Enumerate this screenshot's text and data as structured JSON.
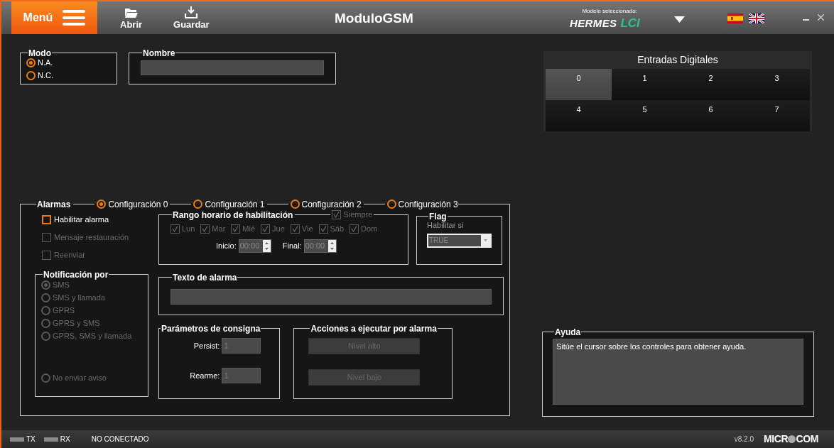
{
  "header": {
    "menu": "Menú",
    "toolbar": [
      {
        "label": "Abrir",
        "kind": "open"
      },
      {
        "label": "Guardar",
        "kind": "save"
      }
    ],
    "title": "ModuloGSM",
    "model_label": "Modelo seleccionado:",
    "model": "HERMES",
    "model_suffix": "LCI",
    "languages": [
      {
        "kind": "es"
      },
      {
        "kind": "en"
      }
    ]
  },
  "modo": {
    "title": "Modo",
    "options": [
      {
        "label": "N.A.",
        "selected": true
      },
      {
        "label": "N.C.",
        "selected": false
      }
    ]
  },
  "nombre": {
    "title": "Nombre"
  },
  "entradas": {
    "title": "Entradas Digitales",
    "inputs": [
      {
        "label": "0",
        "selected": true
      },
      {
        "label": "1",
        "selected": false
      },
      {
        "label": "2",
        "selected": false
      },
      {
        "label": "3",
        "selected": false
      },
      {
        "label": "4",
        "selected": false
      },
      {
        "label": "5",
        "selected": false
      },
      {
        "label": "6",
        "selected": false
      },
      {
        "label": "7",
        "selected": false
      }
    ]
  },
  "alarmas": {
    "title": "Alarmas",
    "configs": [
      {
        "label": "Configuración 0",
        "selected": true
      },
      {
        "label": "Configuración 1",
        "selected": false
      },
      {
        "label": "Configuración 2",
        "selected": false
      },
      {
        "label": "Configuración 3",
        "selected": false
      }
    ],
    "options": [
      {
        "label": "Habilitar alarma",
        "checked": false,
        "disabled": false
      },
      {
        "label": "Mensaje restauración",
        "checked": false,
        "disabled": true
      },
      {
        "label": "Reenviar",
        "checked": false,
        "disabled": true
      }
    ],
    "rango": {
      "title": "Rango horario de habilitación",
      "disabled": true,
      "siempre": {
        "label": "Siempre",
        "checked": true
      },
      "days": [
        {
          "label": "Lun",
          "checked": true
        },
        {
          "label": "Mar",
          "checked": true
        },
        {
          "label": "Mié",
          "checked": true
        },
        {
          "label": "Jue",
          "checked": true
        },
        {
          "label": "Vie",
          "checked": true
        },
        {
          "label": "Sáb",
          "checked": true
        },
        {
          "label": "Dom",
          "checked": true
        }
      ],
      "start_label": "Inicio:",
      "start": "00:00",
      "end_label": "Final:",
      "end": "00:00"
    },
    "flag": {
      "title": "Flag",
      "label": "Habilitar si",
      "value": "TRUE"
    },
    "notificacion": {
      "title": "Notificación por",
      "disabled": true,
      "options": [
        {
          "label": "SMS",
          "selected": true
        },
        {
          "label": "SMS y llamada",
          "selected": false
        },
        {
          "label": "GPRS",
          "selected": false
        },
        {
          "label": "GPRS y SMS",
          "selected": false
        },
        {
          "label": "GPRS, SMS y llamada",
          "selected": false
        },
        {
          "label": "No enviar aviso",
          "selected": false
        }
      ]
    },
    "texto": {
      "title": "Texto de alarma"
    },
    "parametros": {
      "title": "Parámetros de consigna",
      "fields": [
        {
          "label": "Persist:",
          "value": "1"
        },
        {
          "label": "Rearme:",
          "value": "1"
        }
      ]
    },
    "acciones": {
      "title": "Acciones a ejecutar por alarma",
      "buttons": [
        "Nivel alto",
        "Nivel bajo"
      ]
    }
  },
  "ayuda": {
    "title": "Ayuda",
    "text": "Sitúe el cursor sobre los controles para obtener ayuda."
  },
  "status": {
    "indicators": [
      "TX",
      "RX"
    ],
    "connection": "NO CONECTADO",
    "version": "v8.2.0",
    "brand": "MICR",
    "brand_end": "COM"
  }
}
